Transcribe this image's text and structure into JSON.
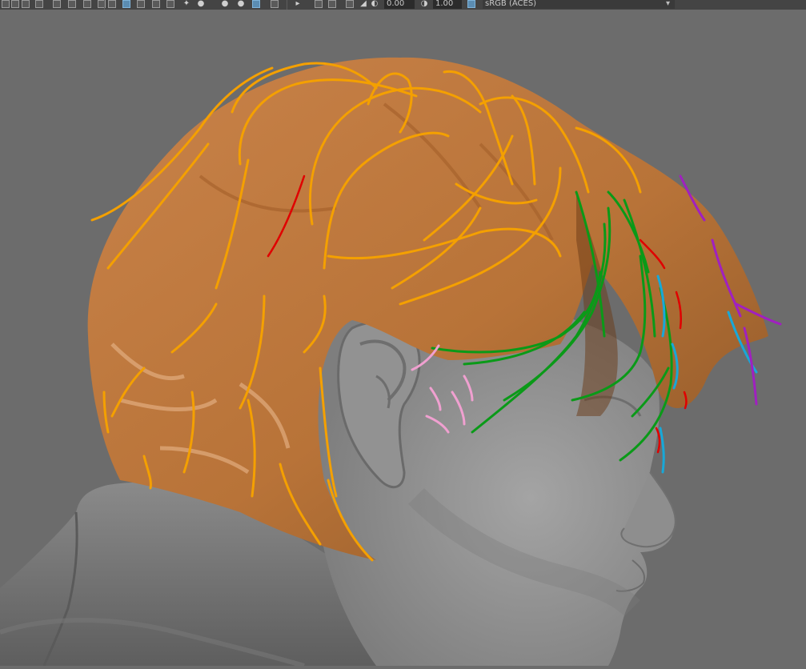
{
  "toolbar": {
    "exposure_value": "0.00",
    "gamma_value": "1.00",
    "color_space": "sRGB (ACES)"
  },
  "viewport": {
    "background_color": "#6c6c6c",
    "hair_color": "#c07a3c",
    "guide_curve_colors": {
      "primary": "#f4a000",
      "bangs": "#0a9a18",
      "sideburn": "#f0a0d0",
      "fringe_blue": "#18a8d8",
      "fringe_purple": "#a020c0",
      "accent": "#e00000"
    }
  }
}
